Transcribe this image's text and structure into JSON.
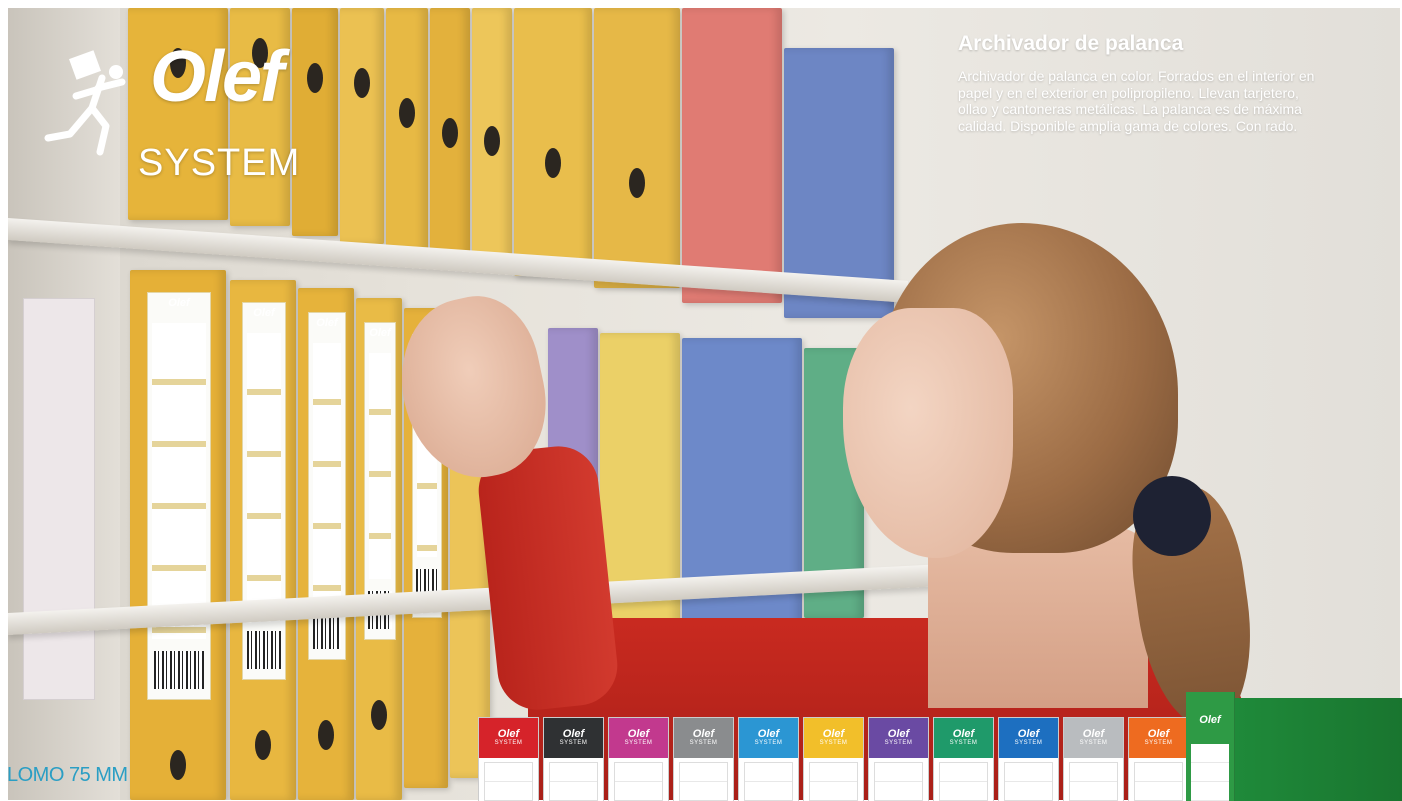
{
  "logo": {
    "brand": "Olef",
    "system": "SYSTEM"
  },
  "product": {
    "title": "Archivador de palanca",
    "description": "Archivador de palanca en color. Forrados en el interior en papel y en el exterior en polipropileno. Llevan tarjetero, ollao y cantoneras metálicas. La palanca es de máxima calidad. Disponible amplia gama de colores. Con rado."
  },
  "spine_label": "LOMO 75 MM",
  "binder_logo": "Olef",
  "binder_system": "SYSTEM",
  "colors": {
    "text_white": "#ffffff",
    "lomo_blue": "#2a9ec4",
    "photo_binders_yellow": "#e8b739",
    "binder_colors": [
      "#d6232a",
      "#2f3133",
      "#c2398e",
      "#8a8c8e",
      "#2b96d3",
      "#f2bf2a",
      "#6a4aa3",
      "#1f9a6a",
      "#1d6fc0",
      "#b9bcbf",
      "#ee6b20",
      "#2e9a45"
    ]
  },
  "icons": {
    "logo_runner": "running-man-carrying-box-icon"
  }
}
